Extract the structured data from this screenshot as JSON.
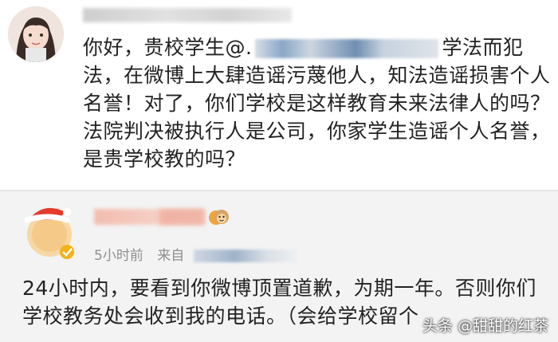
{
  "top_post": {
    "text_line1_a": "你好，贵校学生@.",
    "text_line1_b": "学法而犯",
    "text_rest": "法，在微博上大肆造谣污蔑他人，知法造谣损害个人名誉！对了，你们学校是这样教育未来法律人的吗？法院判决被执行人是公司，你家学生造谣个人名誉，是贵学校教的吗？"
  },
  "reply": {
    "time": "5小时前",
    "source_prefix": "来自",
    "text": "24小时内，要看到你微博顶置道歉，为期一年。否则你们学校教务处会收到我的电话。（会给学校留个"
  },
  "watermark": "头条 @甜甜的红茶",
  "icons": {
    "avatar1": "user-avatar",
    "avatar2": "christmas-hat-avatar",
    "vip_badge": "verified-badge-icon",
    "monkey": "monkey-face-icon"
  },
  "colors": {
    "text": "#222222",
    "meta": "#8f8f8f",
    "bottom_bg": "#f3f3f3"
  }
}
